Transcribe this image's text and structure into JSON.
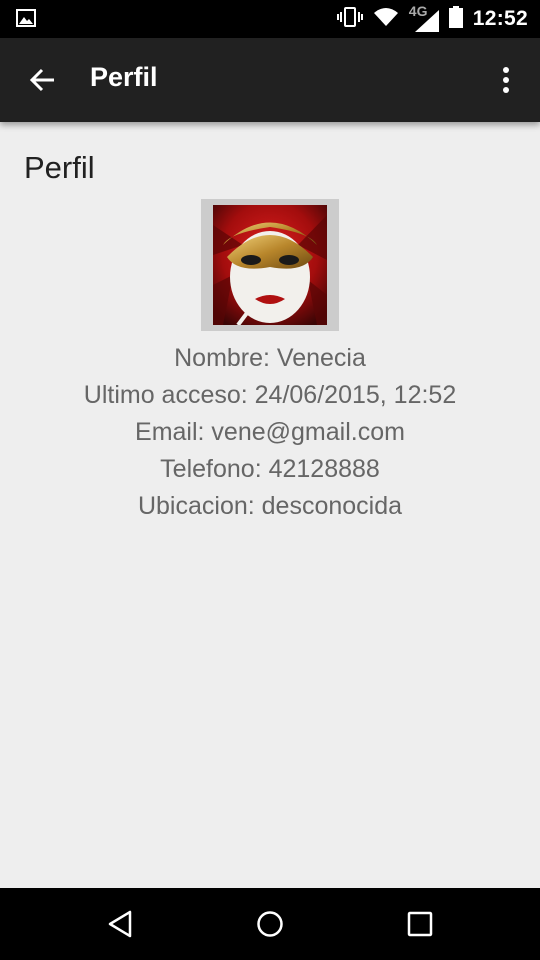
{
  "status_bar": {
    "time": "12:52",
    "network": "4G",
    "icons": [
      "image-notification-icon",
      "vibrate-icon",
      "wifi-icon",
      "cell-signal-icon",
      "battery-icon"
    ]
  },
  "app_bar": {
    "title": "Perfil",
    "back_icon": "arrow-back-icon",
    "overflow_icon": "more-vert-icon"
  },
  "page": {
    "heading": "Perfil",
    "avatar_icon": "venetian-mask-avatar",
    "lines": {
      "name": "Nombre: Venecia",
      "last_access": "Ultimo acceso: 24/06/2015, 12:52",
      "email": "Email: vene@gmail.com",
      "phone": "Telefono: 42128888",
      "location": "Ubicacion: desconocida"
    }
  },
  "nav_bar": {
    "icons": [
      "nav-back-icon",
      "nav-home-icon",
      "nav-recents-icon"
    ]
  },
  "colors": {
    "app_bar": "#212121",
    "background": "#eeeeee",
    "text_secondary": "#666666"
  }
}
